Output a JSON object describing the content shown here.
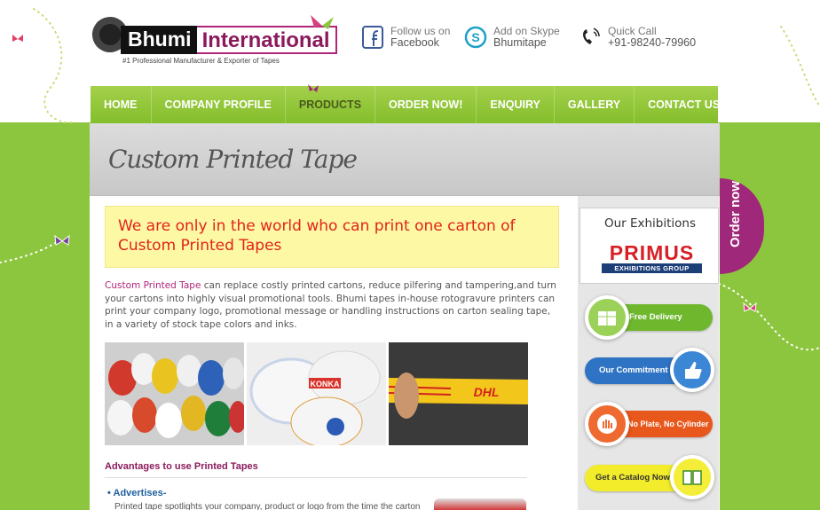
{
  "header": {
    "logo": {
      "name_part1": "Bhumi",
      "name_part2": "International",
      "tagline": "#1 Professional Manufacturer & Exporter of Tapes"
    },
    "social": [
      {
        "icon": "facebook-icon",
        "line1": "Follow us on",
        "line2": "Facebook"
      },
      {
        "icon": "skype-icon",
        "line1": "Add on Skype",
        "line2": "Bhumitape"
      },
      {
        "icon": "phone-icon",
        "line1": "Quick Call",
        "line2": "+91-98240-79960"
      }
    ]
  },
  "nav": {
    "items": [
      "HOME",
      "COMPANY PROFILE",
      "PRODUCTS",
      "ORDER NOW!",
      "ENQUIRY",
      "GALLERY",
      "CONTACT US"
    ],
    "active": "PRODUCTS"
  },
  "page": {
    "title": "Custom Printed Tape",
    "highlight": "We are only in the world who can print one carton of Custom Printed Tapes",
    "intro_lead": "Custom Printed Tape",
    "intro_rest": " can replace costly printed cartons, reduce pilfering and tampering,and turn your cartons into highly visual promotional tools. Bhumi tapes in-house rotogravure printers can print your company logo, promotional message or handling instructions on carton sealing tape, in a variety of stock tape colors and inks.",
    "photos": [
      "assorted-printed-tape-rolls",
      "konka-printed-tape-rolls",
      "dhl-printed-tape"
    ],
    "photo_text": {
      "dhl": "DHL",
      "konka": "KONKA"
    },
    "advantages_title": "Advantages to use Printed Tapes",
    "advantage_item": "Advertises-",
    "advantage_text": "Printed tape spotlights your company, product or logo from the time the carton"
  },
  "sidebar": {
    "exhibitions_title": "Our Exhibitions",
    "primus_name": "PRIMUS",
    "primus_sub": "EXHIBITIONS GROUP",
    "buttons": [
      {
        "label": "Free Delivery",
        "color": "#6fb82e",
        "icon": "boxes-icon"
      },
      {
        "label": "Our Commitment",
        "color": "#2f73c4",
        "icon": "thumbs-up-icon"
      },
      {
        "label": "No Plate, No Cylinder",
        "color": "#e8571c",
        "icon": "stop-hand-icon"
      },
      {
        "label": "Get a Catalog Now",
        "color": "#f2ec2a",
        "icon": "book-icon"
      }
    ],
    "order_tab": "Order now"
  },
  "colors": {
    "green": "#8cc63f",
    "magenta": "#a0287a",
    "red": "#e2231a",
    "yellow": "#fdf8a4"
  }
}
